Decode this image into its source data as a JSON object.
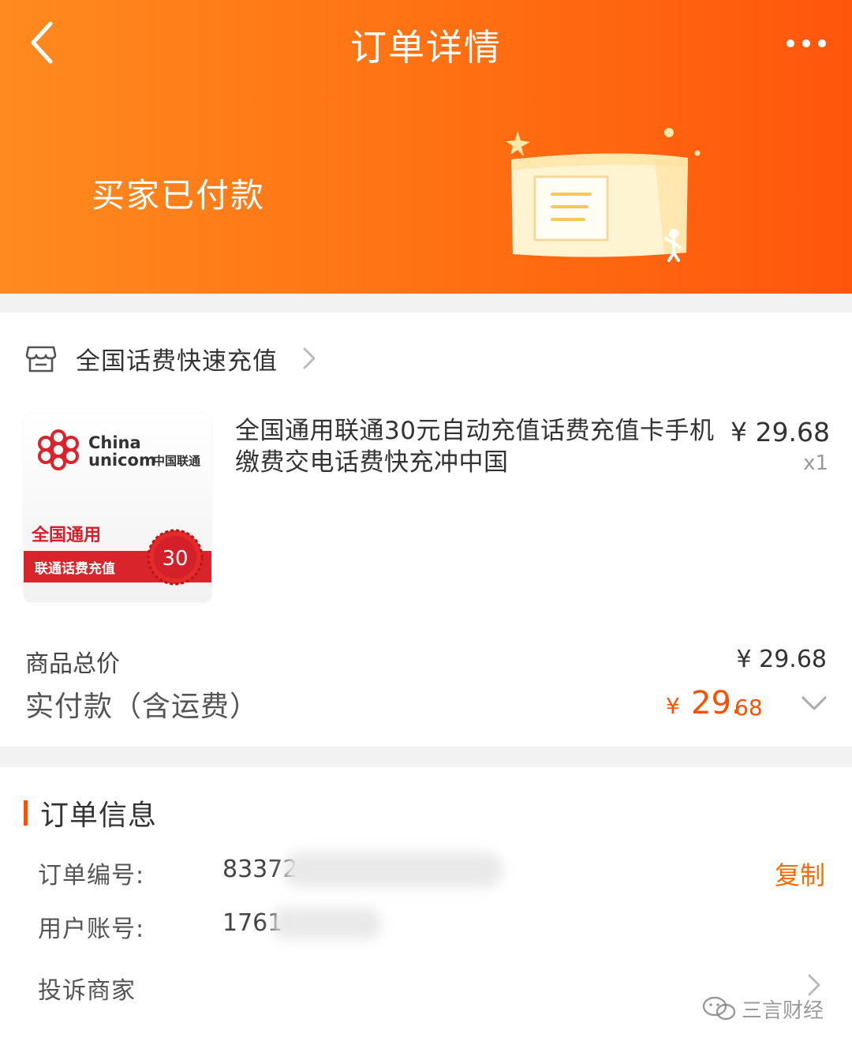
{
  "nav": {
    "title": "订单详情",
    "back_icon": "chevron-left-icon",
    "more_icon": "more-dots-icon"
  },
  "status": {
    "text": "买家已付款",
    "illustration": "package-box-icon"
  },
  "shop": {
    "name": "全国话费快速充值",
    "icon": "store-icon"
  },
  "product": {
    "thumbnail": {
      "brand_en_1": "China",
      "brand_en_2": "unicom",
      "brand_cn": "中国联通",
      "tag": "全国通用",
      "band_text": "联通话费充值",
      "seal_value": "30"
    },
    "title": "全国通用联通30元自动充值话费充值卡手机缴费交电话费快充冲中国",
    "price": "¥ 29.68",
    "quantity": "x1"
  },
  "summary": {
    "goods_total_label": "商品总价",
    "goods_total_value": "¥ 29.68",
    "paid_label": "实付款（含运费）",
    "paid_currency": "¥",
    "paid_int": "29.",
    "paid_dec": "68"
  },
  "order_info": {
    "title": "订单信息",
    "order_no_label": "订单编号:",
    "order_no_value": "83372",
    "account_label": "用户账号:",
    "account_value": "1761",
    "copy_label": "复制",
    "complain_label": "投诉商家"
  },
  "watermark": {
    "text": "三言财经"
  },
  "colors": {
    "accent": "#ff5000",
    "header_start": "#ff8a1f",
    "header_end": "#ff560c",
    "unicom_red": "#d9242b"
  }
}
